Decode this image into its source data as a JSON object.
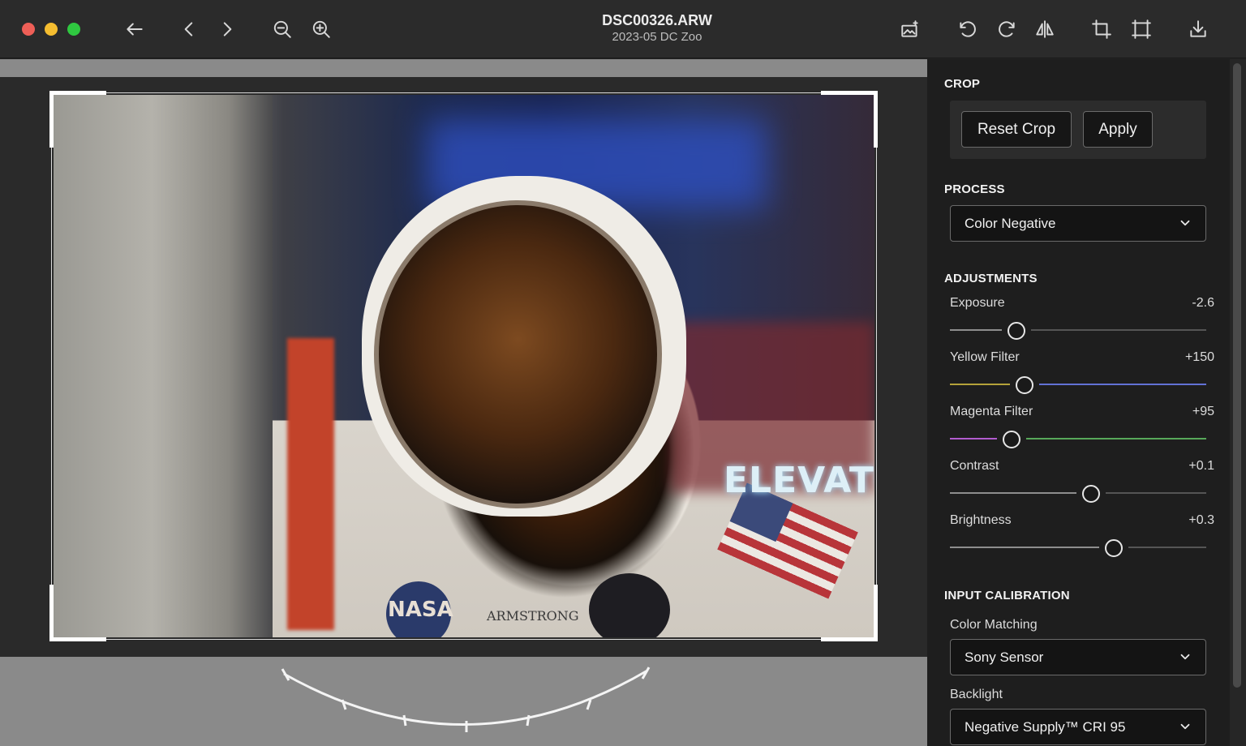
{
  "window": {
    "title": "DSC00326.ARW",
    "subtitle": "2023-05 DC Zoo"
  },
  "toolbar": {
    "left_icons": [
      "back-arrow-icon",
      "previous-icon",
      "next-icon",
      "zoom-out-icon",
      "zoom-in-icon"
    ],
    "right_icons": [
      "image-settings-icon",
      "rotate-left-icon",
      "rotate-right-icon",
      "flip-horizontal-icon",
      "crop-icon",
      "frame-icon",
      "export-icon"
    ]
  },
  "photo": {
    "sign_text": "ELEVATO",
    "patch_text": "NASA",
    "name_tag": "ARMSTRONG"
  },
  "crop": {
    "section_title": "CROP",
    "reset_label": "Reset Crop",
    "apply_label": "Apply"
  },
  "process": {
    "section_title": "PROCESS",
    "selected": "Color Negative"
  },
  "adjustments": {
    "section_title": "ADJUSTMENTS",
    "items": [
      {
        "label": "Exposure",
        "value": "-2.6",
        "position": 0.26
      },
      {
        "label": "Yellow Filter",
        "value": "+150",
        "position": 0.29
      },
      {
        "label": "Magenta Filter",
        "value": "+95",
        "position": 0.24
      },
      {
        "label": "Contrast",
        "value": "+0.1",
        "position": 0.55
      },
      {
        "label": "Brightness",
        "value": "+0.3",
        "position": 0.64
      }
    ]
  },
  "input_calibration": {
    "section_title": "INPUT CALIBRATION",
    "color_matching_label": "Color Matching",
    "color_matching_selected": "Sony Sensor",
    "backlight_label": "Backlight",
    "backlight_selected": "Negative Supply™ CRI 95"
  },
  "colors": {
    "panel_bg": "#1e1e1e",
    "titlebar_bg": "#2b2b2b",
    "canvas_bg": "#8a8a8a",
    "traffic_close": "#ee5f57",
    "traffic_min": "#f5bd30",
    "traffic_max": "#2fc840",
    "yellow_track": "#b5a23a",
    "blue_track": "#6272d6",
    "magenta_track": "#b15ccf",
    "green_track": "#57a85a"
  }
}
